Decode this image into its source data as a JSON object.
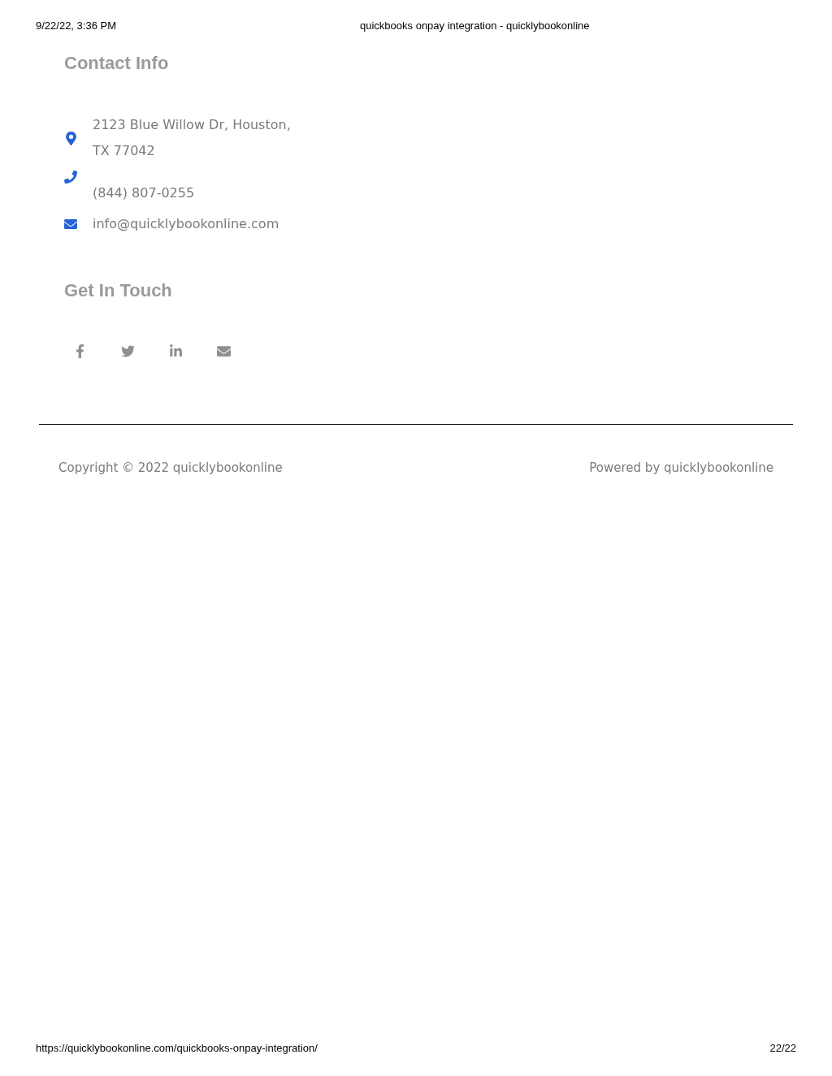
{
  "print_header": {
    "date": "9/22/22, 3:36 PM",
    "title": "quickbooks onpay integration - quicklybookonline"
  },
  "contact_info": {
    "heading": "Contact Info",
    "items": [
      {
        "kind": "address",
        "lines": [
          "2123 Blue Willow Dr, Houston,",
          "TX 77042"
        ]
      },
      {
        "kind": "phone",
        "lines": [
          "(844) 807-0255"
        ]
      },
      {
        "kind": "email",
        "lines": [
          "info@quicklybookonline.com"
        ]
      }
    ]
  },
  "get_in_touch": {
    "heading": "Get In Touch",
    "social": [
      {
        "kind": "facebook"
      },
      {
        "kind": "twitter"
      },
      {
        "kind": "linkedin"
      },
      {
        "kind": "email"
      }
    ]
  },
  "footer": {
    "copyright": "Copyright © 2022 quicklybookonline",
    "powered_by": "Powered by quicklybookonline"
  },
  "print_footer": {
    "url": "https://quicklybookonline.com/quickbooks-onpay-integration/",
    "page": "22/22"
  }
}
